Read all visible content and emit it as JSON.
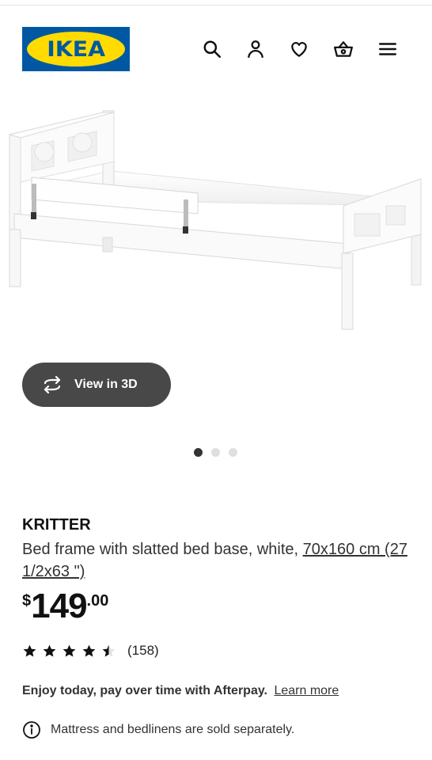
{
  "header": {
    "logo_text": "IKEA",
    "icons": [
      "search-icon",
      "account-icon",
      "heart-icon",
      "basket-icon",
      "menu-icon"
    ]
  },
  "gallery": {
    "view3d_label": "View in 3D",
    "slides_total": 3,
    "active_slide": 1
  },
  "product": {
    "name": "KRITTER",
    "description_plain": "Bed frame with slatted bed base, white, ",
    "description_size": "70x160 cm (27 1/2x63 \")",
    "price_currency": "$",
    "price_integer": "149",
    "price_decimal": ".00"
  },
  "rating": {
    "stars": 4.5,
    "max_stars": 5,
    "count_label": "(158)"
  },
  "afterpay": {
    "text": "Enjoy today, pay over time with Afterpay.",
    "link": "Learn more"
  },
  "notice": {
    "text": "Mattress and bedlinens are sold separately."
  },
  "colors": {
    "ikea_blue": "#0058a3",
    "ikea_yellow": "#ffdb00",
    "button_dark": "#484848"
  }
}
